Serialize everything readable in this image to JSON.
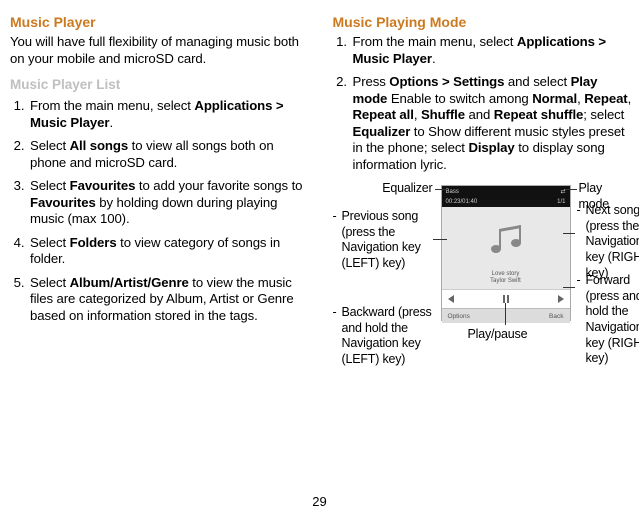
{
  "page_number": "29",
  "left": {
    "h1": "Music Player",
    "intro": "You will have full flexibility of managing music both on your mobile and microSD card.",
    "h2": "Music Player List",
    "li1_a": "From the main menu, select ",
    "li1_b": "Applications > Music Player",
    "li1_c": ".",
    "li2_a": "Select ",
    "li2_b": "All songs",
    "li2_c": " to view all songs both on phone and microSD card.",
    "li3_a": "Select ",
    "li3_b": "Favourites",
    "li3_c": " to add your favorite songs to ",
    "li3_d": "Favourites",
    "li3_e": " by holding down during playing music (max 100).",
    "li4_a": "Select ",
    "li4_b": "Folders",
    "li4_c": " to view category of songs in folder.",
    "li5_a": "Select ",
    "li5_b": "Album/Artist/Genre",
    "li5_c": " to view the music files are categorized by Album, Artist or Genre based on information stored in the tags."
  },
  "right": {
    "h1": "Music Playing Mode",
    "li1_a": "From the main menu, select ",
    "li1_b": "Applications > Music Player",
    "li1_c": ".",
    "li2_a": "Press ",
    "li2_b": "Options > Settings",
    "li2_c": " and select ",
    "li2_d": "Play mode",
    "li2_e": " Enable to switch among ",
    "li2_f": "Normal",
    "li2_g": ", ",
    "li2_h": "Repeat",
    "li2_i": ", ",
    "li2_j": "Repeat all",
    "li2_k": ", ",
    "li2_l": "Shuffle",
    "li2_m": " and ",
    "li2_n": "Repeat shuffle",
    "li2_o": "; select ",
    "li2_p": "Equalizer",
    "li2_q": " to Show different music styles preset in the phone; select ",
    "li2_r": "Display",
    "li2_s": " to display song information lyric."
  },
  "diagram": {
    "equalizer": "Equalizer",
    "play_mode": "Play mode",
    "prev_song": "Previous song (press the Navigation key (LEFT) key)",
    "backward": "Backward (press and hold the Navigation key (LEFT) key)",
    "play_pause": "Play/pause",
    "next_song": "Next song (press the Navigation key (RIGHT) key)",
    "forward": "Forward (press and hold the Navigation key (RIGHT) key)",
    "bass": "Bass",
    "time_left": "00:23/01:40",
    "track_count": "1/1",
    "song_title": "Love story",
    "song_artist": "Taylor Swift",
    "options": "Options",
    "back": "Back"
  }
}
